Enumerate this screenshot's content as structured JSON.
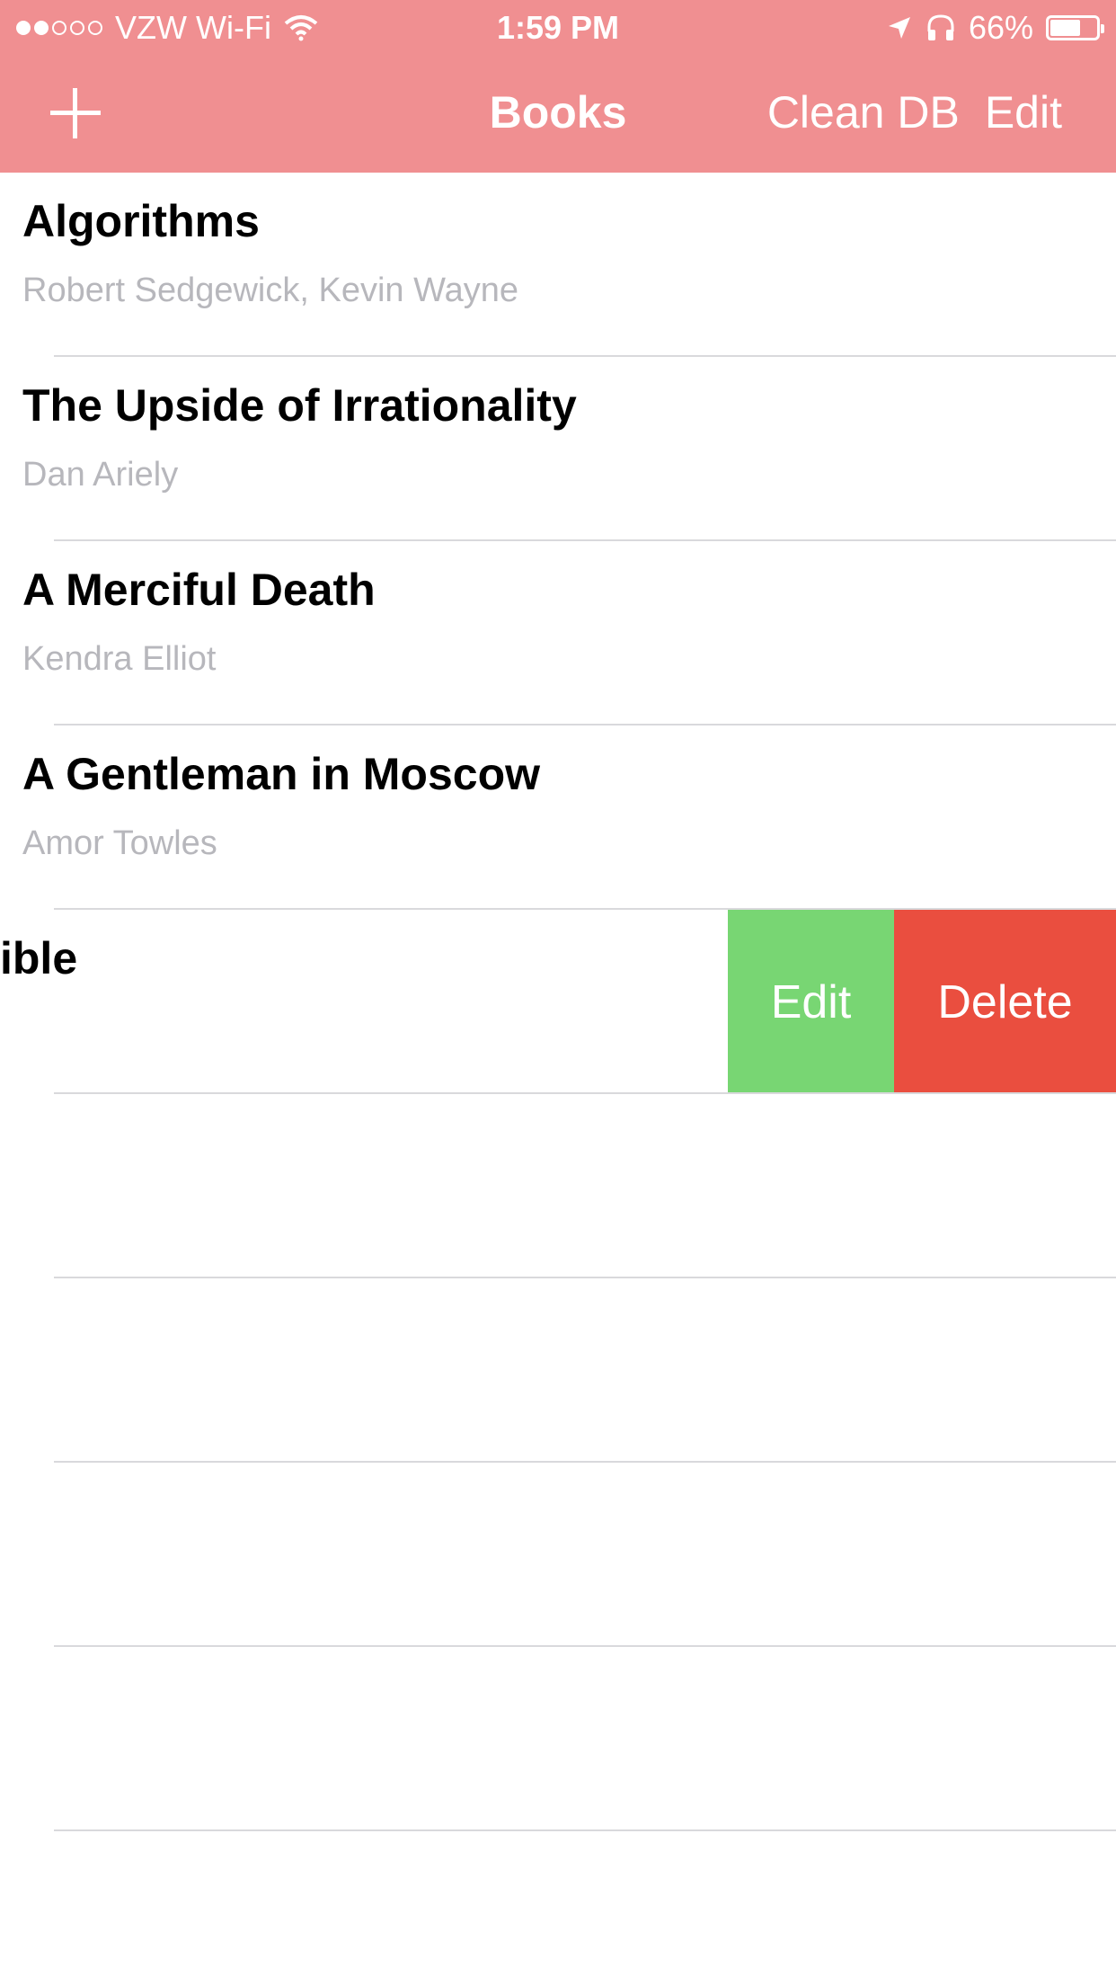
{
  "status_bar": {
    "carrier": "VZW Wi-Fi",
    "time": "1:59 PM",
    "battery": "66%",
    "battery_level": 0.66,
    "signal_bars_filled": 2,
    "signal_bars_total": 5,
    "icons": [
      "wifi-icon",
      "location-arrow-icon",
      "headphones-icon",
      "battery-icon"
    ]
  },
  "nav": {
    "title": "Books",
    "add_icon": "plus-icon",
    "clean_label": "Clean DB",
    "edit_label": "Edit"
  },
  "books": [
    {
      "title": "Algorithms",
      "author": "Robert Sedgewick, Kevin Wayne"
    },
    {
      "title": "The Upside of Irrationality",
      "author": "Dan Ariely"
    },
    {
      "title": "A Merciful Death",
      "author": "Kendra Elliot"
    },
    {
      "title": "A Gentleman in Moscow",
      "author": "Amor Towles"
    }
  ],
  "swiped_row": {
    "title_visible": "ible",
    "edit_action": "Edit",
    "delete_action": "Delete"
  },
  "colors": {
    "nav_background": "#f08f91",
    "edit_action": "#78d673",
    "delete_action": "#ea4e3f",
    "author_text": "#b7b7bc"
  }
}
